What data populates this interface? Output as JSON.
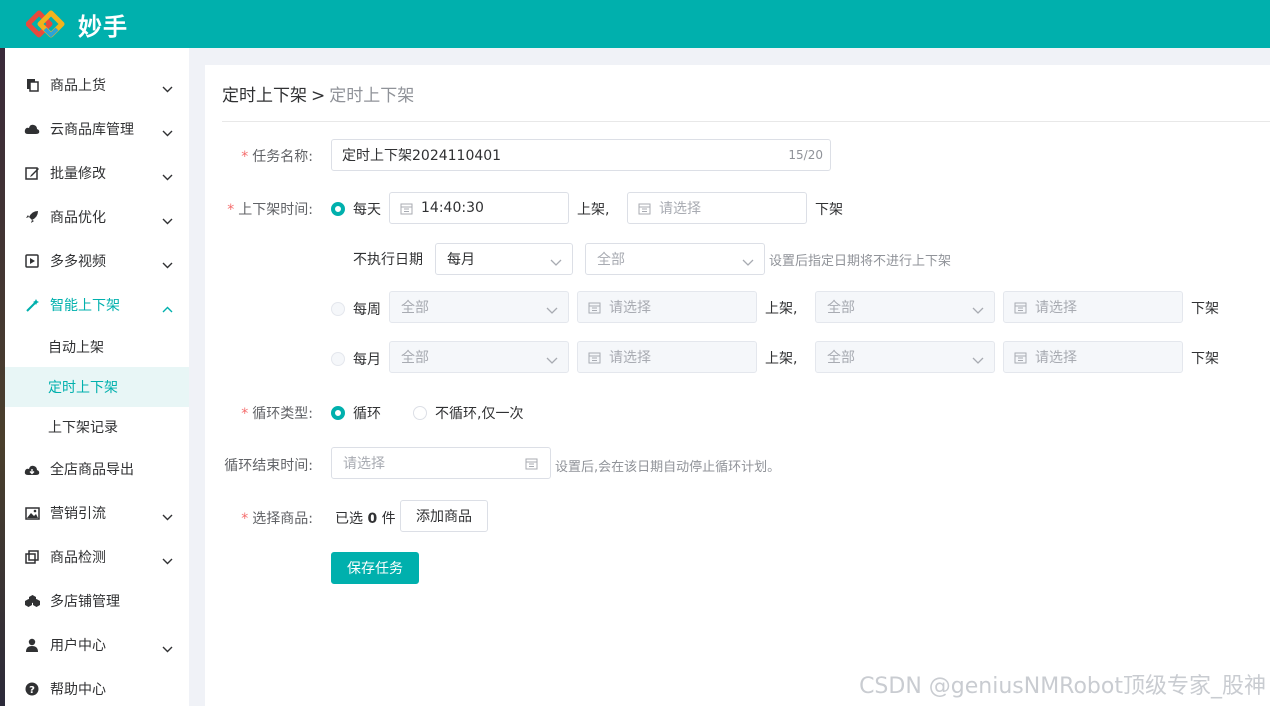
{
  "app": {
    "brand": "妙手",
    "brand_colors": [
      "#e84a3c",
      "#f2b31c",
      "#2aa3d8"
    ],
    "accent": "#00b0ad"
  },
  "sidebar": {
    "items": [
      {
        "label": "商品上货",
        "icon": "copy-icon",
        "chevron": "down"
      },
      {
        "label": "云商品库管理",
        "icon": "cloud-icon",
        "chevron": "down"
      },
      {
        "label": "批量修改",
        "icon": "edit-icon",
        "chevron": "down"
      },
      {
        "label": "商品优化",
        "icon": "rocket-icon",
        "chevron": "down"
      },
      {
        "label": "多多视频",
        "icon": "video-icon",
        "chevron": "down"
      },
      {
        "label": "智能上下架",
        "icon": "magic-wand-icon",
        "chevron": "up",
        "active": true
      },
      {
        "label": "全店商品导出",
        "icon": "cloud-download-icon",
        "chevron": ""
      },
      {
        "label": "营销引流",
        "icon": "image-icon",
        "chevron": "down"
      },
      {
        "label": "商品检测",
        "icon": "clone-icon",
        "chevron": "down"
      },
      {
        "label": "多店铺管理",
        "icon": "cubes-icon",
        "chevron": ""
      },
      {
        "label": "用户中心",
        "icon": "user-icon",
        "chevron": "down"
      },
      {
        "label": "帮助中心",
        "icon": "question-circle-icon",
        "chevron": ""
      }
    ],
    "submenu": [
      {
        "label": "自动上架"
      },
      {
        "label": "定时上下架",
        "selected": true
      },
      {
        "label": "上下架记录"
      }
    ]
  },
  "breadcrumb": {
    "current": "定时上下架",
    "separator": ">",
    "last": "定时上下架"
  },
  "form": {
    "task_name": {
      "label": "任务名称:",
      "value": "定时上下架2024110401",
      "counter": "15/20"
    },
    "schedule": {
      "label": "上下架时间:",
      "daily": {
        "option": "每天",
        "up_time": "14:40:30",
        "up_suffix": "上架,",
        "down_placeholder": "请选择",
        "down_suffix": "下架"
      },
      "exclude": {
        "label": "不执行日期",
        "period": "每月",
        "days": "全部",
        "hint": "设置后指定日期将不进行上下架"
      },
      "weekly": {
        "option": "每周",
        "up_day": "全部",
        "up_time_placeholder": "请选择",
        "up_suffix": "上架,",
        "down_day": "全部",
        "down_time_placeholder": "请选择",
        "down_suffix": "下架"
      },
      "monthly": {
        "option": "每月",
        "up_day": "全部",
        "up_time_placeholder": "请选择",
        "up_suffix": "上架,",
        "down_day": "全部",
        "down_time_placeholder": "请选择",
        "down_suffix": "下架"
      }
    },
    "loop_type": {
      "label": "循环类型:",
      "options": [
        "循环",
        "不循环,仅一次"
      ]
    },
    "loop_end": {
      "label": "循环结束时间:",
      "placeholder": "请选择",
      "hint": "设置后,会在该日期自动停止循环计划。"
    },
    "goods": {
      "label": "选择商品:",
      "prefix": "已选",
      "count": "0",
      "unit": "件",
      "add_button": "添加商品"
    },
    "save_button": "保存任务"
  },
  "watermark": "CSDN @geniusNMRobot顶级专家_股神"
}
